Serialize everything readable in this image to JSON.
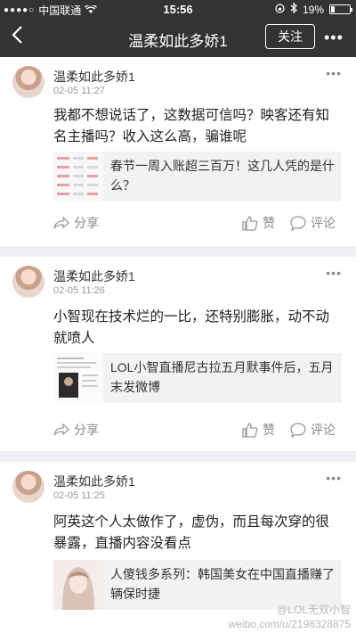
{
  "status": {
    "carrier": "中国联通",
    "time": "15:56",
    "battery": "19%"
  },
  "nav": {
    "title": "温柔如此多娇1",
    "follow": "关注"
  },
  "posts": [
    {
      "user": "温柔如此多娇1",
      "time": "02-05 11:27",
      "text": "我都不想说话了，这数据可信吗？映客还有知名主播吗？收入这么高，骗谁呢",
      "share": "春节一周入账超三百万！这几人凭的是什么？"
    },
    {
      "user": "温柔如此多娇1",
      "time": "02-05 11:26",
      "text": "小智现在技术烂的一比，还特别膨胀，动不动就喷人",
      "share": "LOL小智直播尼古拉五月默事件后，五月末发微博"
    },
    {
      "user": "温柔如此多娇1",
      "time": "02-05 11:25",
      "text": "阿英这个人太做作了，虚伪，而且每次穿的很暴露，直播内容没看点",
      "share": "人傻钱多系列：韩国美女在中国直播赚了辆保时捷"
    }
  ],
  "actions": {
    "share": "分享",
    "like": "赞",
    "comment": "评论"
  },
  "watermark": {
    "line1": "@LOL无双小智",
    "line2": "weibo.com/u/2198328875"
  }
}
